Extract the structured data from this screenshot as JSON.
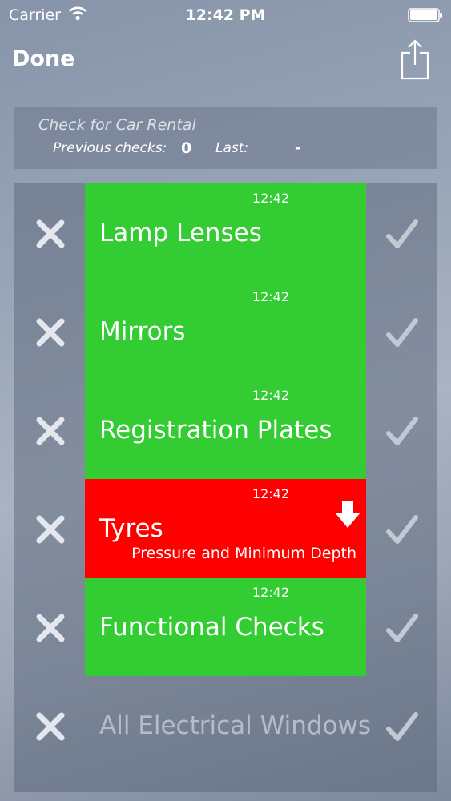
{
  "status_bar": {
    "carrier": "Carrier",
    "time": "12:42 PM"
  },
  "nav": {
    "done_label": "Done"
  },
  "summary": {
    "title": "Check for Car Rental",
    "previous_label": "Previous checks:",
    "previous_count": "0",
    "last_label": "Last:",
    "last_value": "-"
  },
  "items": [
    {
      "time": "12:42",
      "title": "Lamp Lenses",
      "subtitle": "",
      "state": "pass"
    },
    {
      "time": "12:42",
      "title": "Mirrors",
      "subtitle": "",
      "state": "pass"
    },
    {
      "time": "12:42",
      "title": "Registration Plates",
      "subtitle": "",
      "state": "pass"
    },
    {
      "time": "12:42",
      "title": "Tyres",
      "subtitle": "Pressure and Minimum Depth",
      "state": "fail"
    },
    {
      "time": "12:42",
      "title": "Functional Checks",
      "subtitle": "",
      "state": "pass"
    },
    {
      "time": "",
      "title": "All Electrical Windows",
      "subtitle": "",
      "state": "unchecked"
    }
  ],
  "colors": {
    "pass": "#33cc33",
    "fail": "#ff0000"
  }
}
